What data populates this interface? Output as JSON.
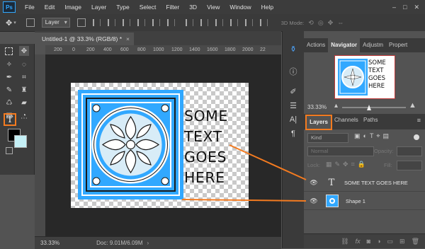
{
  "app": {
    "logo": "Ps"
  },
  "menubar": {
    "items": [
      "File",
      "Edit",
      "Image",
      "Layer",
      "Type",
      "Select",
      "Filter",
      "3D",
      "View",
      "Window",
      "Help"
    ],
    "window_controls": [
      "–",
      "□",
      "✕"
    ]
  },
  "options_bar": {
    "auto_select_target": "Layer",
    "mode_3d_label": "3D Mode:"
  },
  "document": {
    "tab_title": "Untitled-1 @ 33.3% (RGB/8) *",
    "text_lines": [
      "SOME",
      "TEXT",
      "GOES",
      "HERE"
    ],
    "ruler_ticks": [
      "200",
      "0",
      "200",
      "400",
      "600",
      "800",
      "1000",
      "1200",
      "1400",
      "1600",
      "1800",
      "2000",
      "22"
    ],
    "shape_color": "#31a8ff"
  },
  "status": {
    "zoom": "33.33%",
    "doc_info": "Doc: 9.01M/6.09M"
  },
  "navigator": {
    "tabs": [
      "Actions",
      "Navigator",
      "Adjustm",
      "Propert"
    ],
    "active_tab": "Navigator",
    "zoom": "33.33%",
    "thumb_lines": [
      "SOME",
      "TEXT",
      "GOES",
      "HERE"
    ]
  },
  "layers_panel": {
    "tabs": [
      "Layers",
      "Channels",
      "Paths"
    ],
    "active_tab": "Layers",
    "kind_filter": "Kind",
    "blend_mode": "Normal",
    "opacity_label": "Opacity:",
    "lock_label": "Lock:",
    "fill_label": "Fill:",
    "layers": [
      {
        "name": "SOME TEXT GOES HERE",
        "type": "text",
        "thumb": "T"
      },
      {
        "name": "Shape 1",
        "type": "shape"
      }
    ]
  },
  "colors": {
    "highlight": "#f47b20",
    "accent": "#31a8ff",
    "foreground": "#000000",
    "background": "#c5f0f6"
  }
}
